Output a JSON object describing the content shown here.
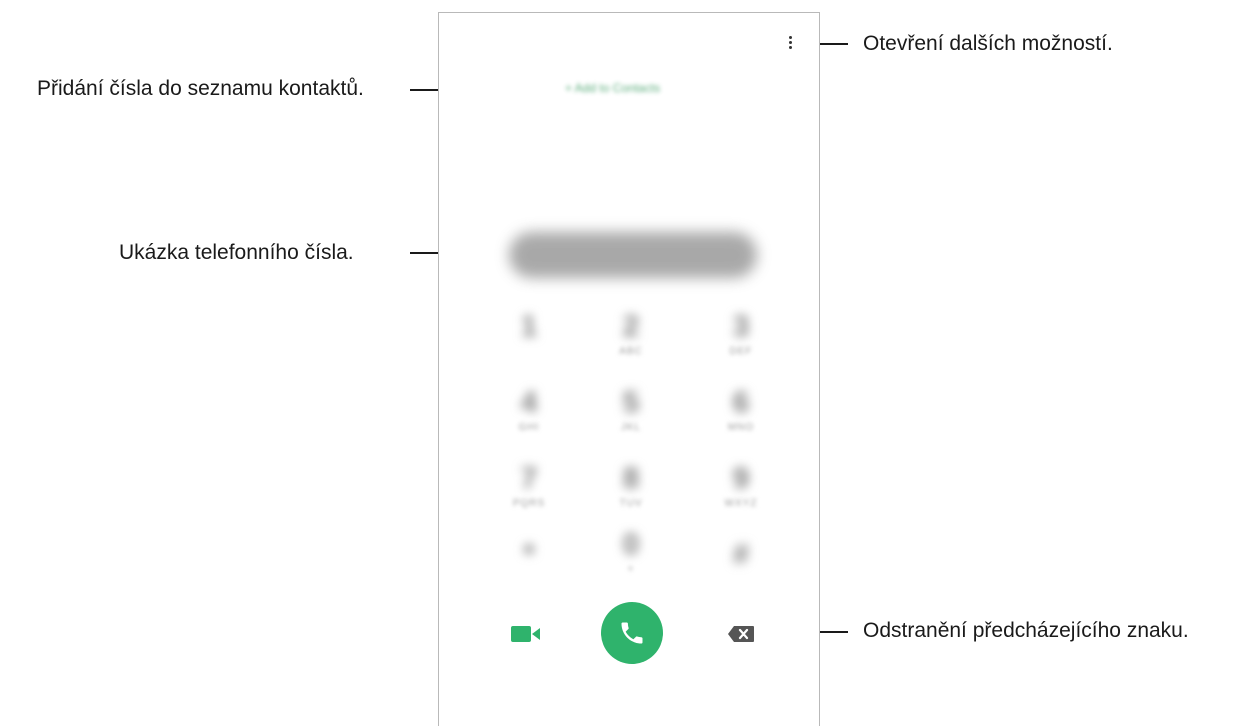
{
  "callouts": {
    "more_options": "Otevření dalších možností.",
    "add_contact": "Přidání čísla do seznamu kontaktů.",
    "number_preview": "Ukázka telefonního čísla.",
    "delete_char": "Odstranění předcházejícího znaku."
  },
  "phone": {
    "add_to_contacts_label": "+ Add to Contacts",
    "keypad": [
      {
        "digit": "1",
        "letters": ""
      },
      {
        "digit": "2",
        "letters": "ABC"
      },
      {
        "digit": "3",
        "letters": "DEF"
      },
      {
        "digit": "4",
        "letters": "GHI"
      },
      {
        "digit": "5",
        "letters": "JKL"
      },
      {
        "digit": "6",
        "letters": "MNO"
      },
      {
        "digit": "7",
        "letters": "PQRS"
      },
      {
        "digit": "8",
        "letters": "TUV"
      },
      {
        "digit": "9",
        "letters": "WXYZ"
      },
      {
        "digit": "*",
        "letters": ""
      },
      {
        "digit": "0",
        "letters": "+"
      },
      {
        "digit": "#",
        "letters": ""
      }
    ],
    "icons": {
      "more": "more-vertical-icon",
      "video": "video-call-icon",
      "call": "phone-call-icon",
      "backspace": "backspace-icon"
    },
    "colors": {
      "accent": "#2fb36c",
      "contact_link": "#4aa46e",
      "frame": "#b9b9b9"
    }
  }
}
